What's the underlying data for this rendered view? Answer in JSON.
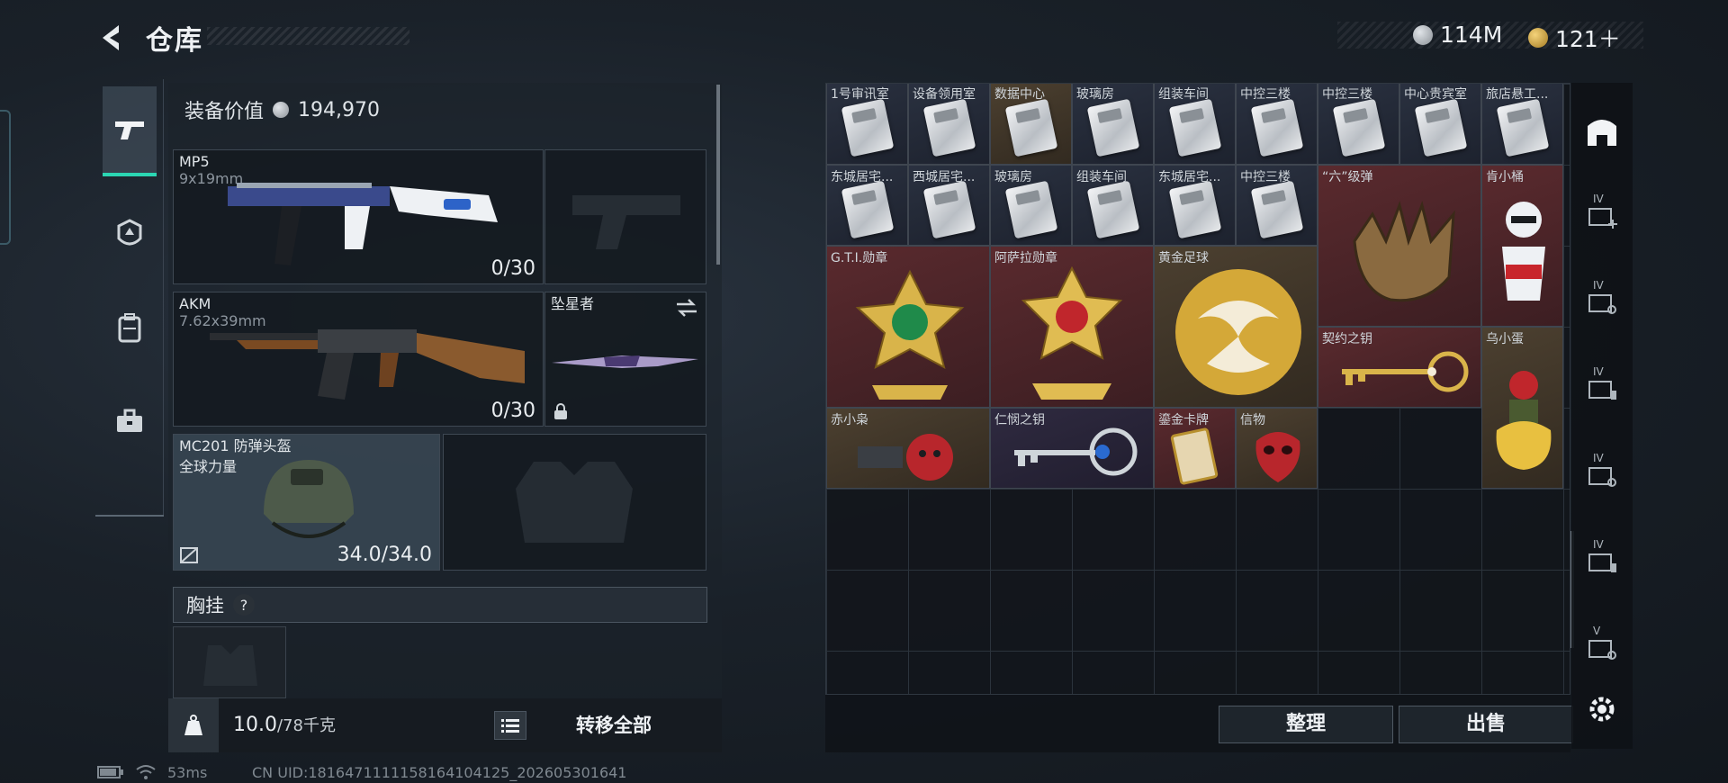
{
  "header": {
    "title": "仓库",
    "currency": [
      {
        "icon": "silver-coin-icon",
        "value": "114M"
      },
      {
        "icon": "gold-coin-icon",
        "value": "121＋"
      }
    ]
  },
  "loadout": {
    "equip_value_label": "装备价值",
    "equip_value": "194,970",
    "slots": {
      "primary1": {
        "name": "MP5",
        "ammo": "9x19mm",
        "count": "0/30"
      },
      "primary2": {
        "name": "AKM",
        "ammo": "7.62x39mm",
        "count": "0/30"
      },
      "melee": {
        "name": "坠星者"
      },
      "helmet": {
        "name": "MC201 防弹头盔",
        "sub": "全球力量",
        "durability": "34.0/34.0"
      }
    },
    "chest_rig_label": "胸挂",
    "chest_rig_help": "?",
    "weight": "10.0",
    "weight_max": "/78千克",
    "transfer_all": "转移全部"
  },
  "stash": {
    "items": [
      {
        "name": "1号审讯室",
        "rarity": "blue"
      },
      {
        "name": "设备领用室",
        "rarity": "blue"
      },
      {
        "name": "数据中心",
        "rarity": "gold"
      },
      {
        "name": "玻璃房",
        "rarity": "blue"
      },
      {
        "name": "组装车间",
        "rarity": "blue"
      },
      {
        "name": "中控三楼",
        "rarity": "blue"
      },
      {
        "name": "中控三楼",
        "rarity": "blue"
      },
      {
        "name": "中心贵宾室",
        "rarity": "blue"
      },
      {
        "name": "旅店悬工...",
        "rarity": "blue"
      },
      {
        "name": "东城居宅...",
        "rarity": "blue"
      },
      {
        "name": "西城居宅...",
        "rarity": "blue"
      },
      {
        "name": "玻璃房",
        "rarity": "blue"
      },
      {
        "name": "组装车间",
        "rarity": "blue"
      },
      {
        "name": "东城居宅...",
        "rarity": "blue"
      },
      {
        "name": "中控三楼",
        "rarity": "blue"
      },
      {
        "name": "“六”级弹",
        "rarity": "red"
      },
      {
        "name": "肯小桶",
        "rarity": "red"
      },
      {
        "name": "G.T.I.勋章",
        "rarity": "red"
      },
      {
        "name": "阿萨拉勋章",
        "rarity": "red"
      },
      {
        "name": "黄金足球",
        "rarity": "gold"
      },
      {
        "name": "契约之钥",
        "rarity": "red"
      },
      {
        "name": "乌小蛋",
        "rarity": "gold"
      },
      {
        "name": "赤小枭",
        "rarity": "gold"
      },
      {
        "name": "仁悯之钥",
        "rarity": "purple"
      },
      {
        "name": "鎏金卡牌",
        "rarity": "red"
      },
      {
        "name": "信物",
        "rarity": "gold"
      }
    ],
    "sort_label": "整理",
    "sell_label": "出售"
  },
  "rail": {
    "labels": [
      "IV",
      "IV",
      "IV",
      "IV",
      "IV",
      "V"
    ]
  },
  "status": {
    "ping": "53ms",
    "uid": "CN UID:1816471111158164104125_202605301641"
  },
  "colors": {
    "accent": "#2bd6b3",
    "rarity_red": "#5a2a2e",
    "rarity_gold": "#4c4030",
    "rarity_purple": "#2f2a40"
  }
}
